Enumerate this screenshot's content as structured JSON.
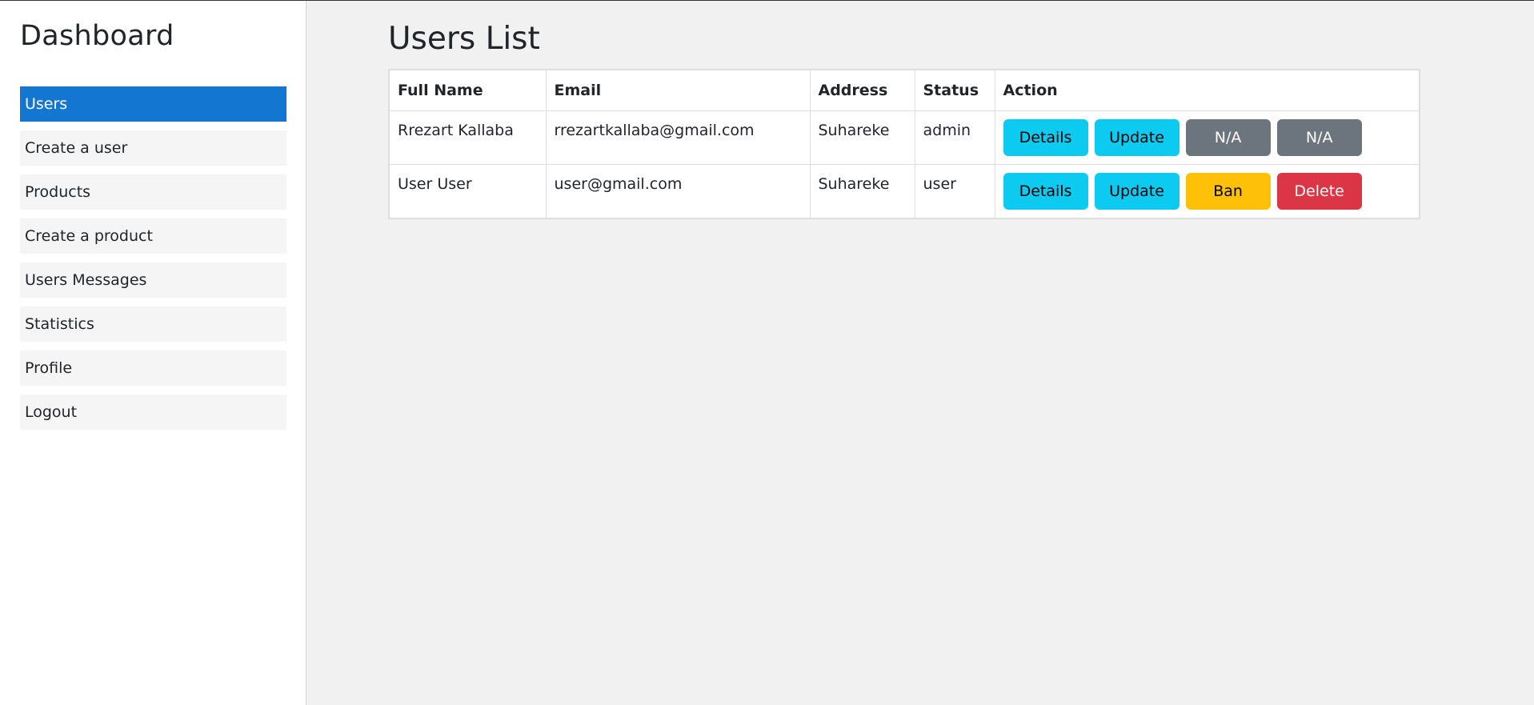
{
  "sidebar": {
    "brand": "Dashboard",
    "items": [
      {
        "label": "Users"
      },
      {
        "label": "Create a user"
      },
      {
        "label": "Products"
      },
      {
        "label": "Create a product"
      },
      {
        "label": "Users Messages"
      },
      {
        "label": "Statistics"
      },
      {
        "label": "Profile"
      },
      {
        "label": "Logout"
      }
    ]
  },
  "main": {
    "title": "Users List",
    "table": {
      "headers": [
        "Full Name",
        "Email",
        "Address",
        "Status",
        "Action"
      ],
      "rows": [
        {
          "full_name": "Rrezart Kallaba",
          "email": "rrezartkallaba@gmail.com",
          "address": "Suhareke",
          "status": "admin",
          "actions": [
            "Details",
            "Update",
            "N/A",
            "N/A"
          ]
        },
        {
          "full_name": "User User",
          "email": "user@gmail.com",
          "address": "Suhareke",
          "status": "user",
          "actions": [
            "Details",
            "Update",
            "Ban",
            "Delete"
          ]
        }
      ]
    }
  },
  "colors": {
    "active_nav": "#1376d1",
    "info": "#0dcaf0",
    "secondary": "#6c757d",
    "warning": "#ffc107",
    "danger": "#dc3545"
  }
}
